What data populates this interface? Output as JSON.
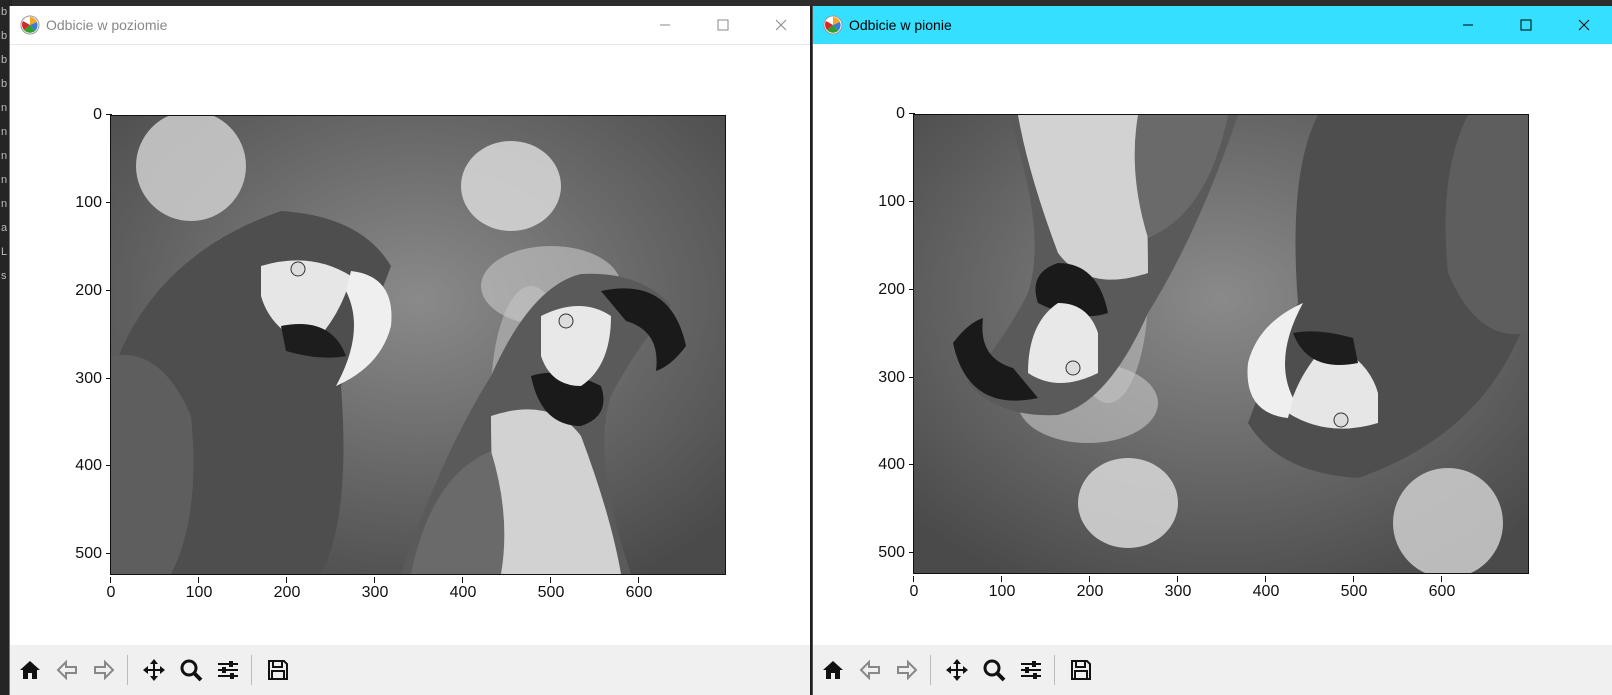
{
  "background": {
    "strip_chars": [
      "b",
      "b",
      "b",
      "b",
      "n",
      "n",
      "n",
      "n",
      "n",
      "a",
      "L",
      "s"
    ]
  },
  "windows": [
    {
      "title": "Odbicie w poziomie",
      "active": false,
      "icon": "matplotlib-logo-icon",
      "image_orientation": "horizontal-flip",
      "ytick_labels": [
        "0",
        "100",
        "200",
        "300",
        "400",
        "500"
      ],
      "xtick_labels": [
        "0",
        "100",
        "200",
        "300",
        "400",
        "500",
        "600"
      ],
      "toolbar": [
        "home-icon",
        "back-arrow-icon",
        "forward-arrow-icon",
        "pan-icon",
        "zoom-icon",
        "configure-icon",
        "save-icon"
      ]
    },
    {
      "title": "Odbicie w pionie",
      "active": true,
      "icon": "matplotlib-logo-icon",
      "image_orientation": "vertical-flip",
      "ytick_labels": [
        "0",
        "100",
        "200",
        "300",
        "400",
        "500"
      ],
      "xtick_labels": [
        "0",
        "100",
        "200",
        "300",
        "400",
        "500",
        "600"
      ],
      "toolbar": [
        "home-icon",
        "back-arrow-icon",
        "forward-arrow-icon",
        "pan-icon",
        "zoom-icon",
        "configure-icon",
        "save-icon"
      ]
    }
  ],
  "colors": {
    "active_titlebar": "#34dfff",
    "toolbar_bg": "#f0f0f0"
  },
  "window_controls": [
    "minimize-icon",
    "maximize-icon",
    "close-icon"
  ]
}
